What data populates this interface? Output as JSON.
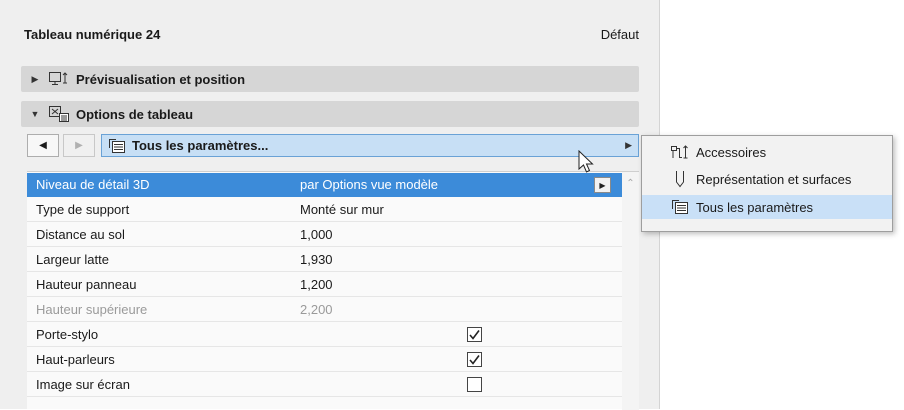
{
  "panel": {
    "title": "Tableau numérique 24",
    "default_label": "Défaut",
    "sections": [
      {
        "label": "Prévisualisation et position",
        "expanded": false,
        "icon": "preview-position-icon"
      },
      {
        "label": "Options de tableau",
        "expanded": true,
        "icon": "table-options-icon"
      }
    ]
  },
  "navigator": {
    "prev_icon": "triangle-left-icon",
    "next_icon": "triangle-right-icon",
    "selected_label": "Tous les paramètres...",
    "selected_icon": "all-parameters-icon"
  },
  "parameters": [
    {
      "name": "Niveau de détail 3D",
      "value": "par Options vue modèle",
      "selected": true,
      "has_dropdown": true
    },
    {
      "name": "Type de support",
      "value": "Monté sur mur"
    },
    {
      "name": "Distance au sol",
      "value": "1,000"
    },
    {
      "name": "Largeur latte",
      "value": "1,930"
    },
    {
      "name": "Hauteur panneau",
      "value": "1,200"
    },
    {
      "name": "Hauteur supérieure",
      "value": "2,200",
      "disabled": true
    },
    {
      "name": "Porte-stylo",
      "checkbox": true,
      "checked": true
    },
    {
      "name": "Haut-parleurs",
      "checkbox": true,
      "checked": true
    },
    {
      "name": "Image sur écran",
      "checkbox": true,
      "checked": false
    }
  ],
  "popup_menu": {
    "items": [
      {
        "label": "Accessoires",
        "icon": "accessories-icon"
      },
      {
        "label": "Représentation et surfaces",
        "icon": "representation-icon"
      },
      {
        "label": "Tous les paramètres",
        "icon": "all-parameters-icon",
        "active": true
      }
    ]
  },
  "colors": {
    "panel_bg": "#efefef",
    "section_bg": "#d6d6d6",
    "selected_row": "#3c8bd9",
    "selector_bg": "#c7dff5",
    "popup_active": "#c9e0f7"
  }
}
